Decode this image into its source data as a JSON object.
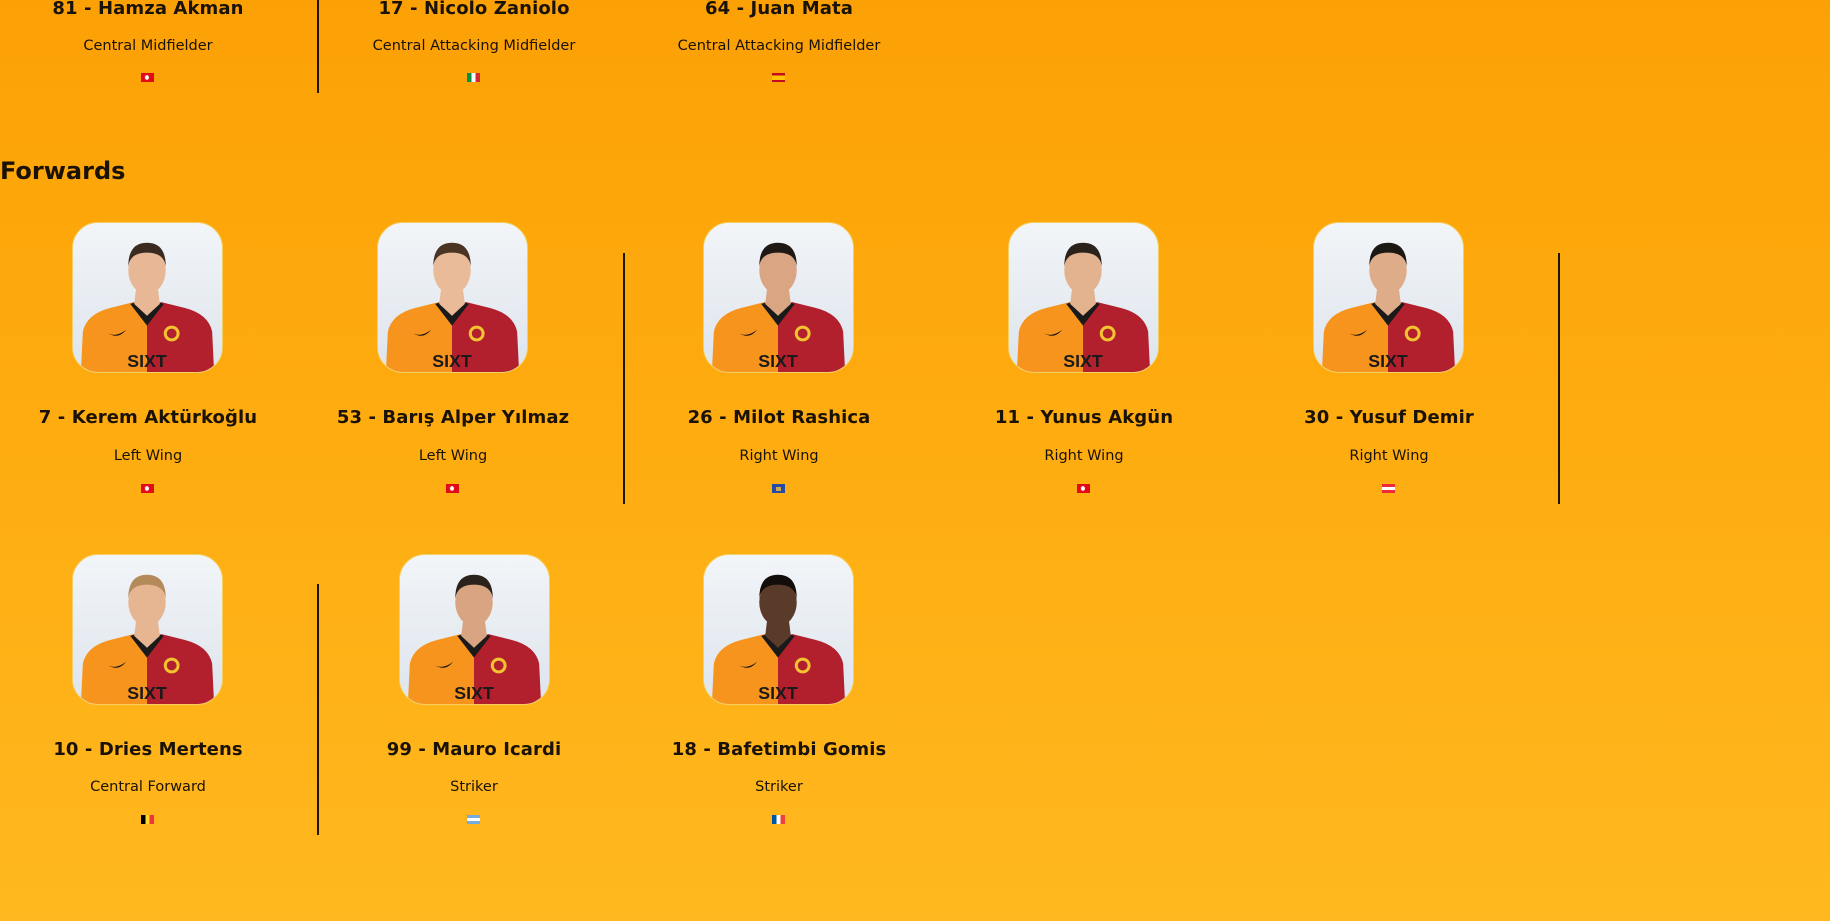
{
  "top_row": [
    {
      "name": "81 - Hamza Akman",
      "position": "Central Midfielder",
      "flag": "turkey"
    },
    {
      "name": "17 - Nicolo Zaniolo",
      "position": "Central Attacking Midfielder",
      "flag": "italy"
    },
    {
      "name": "64 - Juan Mata",
      "position": "Central Attacking Midfielder",
      "flag": "spain"
    }
  ],
  "forwards": {
    "title": "Forwards",
    "row1": [
      {
        "name": "7 - Kerem Aktürkoğlu",
        "position": "Left Wing",
        "flag": "turkey"
      },
      {
        "name": "53 - Barış Alper Yılmaz",
        "position": "Left Wing",
        "flag": "turkey"
      },
      {
        "name": "26 - Milot Rashica",
        "position": "Right Wing",
        "flag": "kosovo"
      },
      {
        "name": "11 - Yunus Akgün",
        "position": "Right Wing",
        "flag": "turkey"
      },
      {
        "name": "30 - Yusuf Demir",
        "position": "Right Wing",
        "flag": "austria"
      }
    ],
    "row2": [
      {
        "name": "10 - Dries Mertens",
        "position": "Central Forward",
        "flag": "belgium"
      },
      {
        "name": "99 - Mauro Icardi",
        "position": "Striker",
        "flag": "argentina"
      },
      {
        "name": "18 - Bafetimbi Gomis",
        "position": "Striker",
        "flag": "france"
      }
    ]
  },
  "colors": {
    "background_top": "#fca105",
    "background_bottom": "#ffb81f",
    "jersey_orange": "#f7941d",
    "jersey_red": "#b3202d"
  }
}
